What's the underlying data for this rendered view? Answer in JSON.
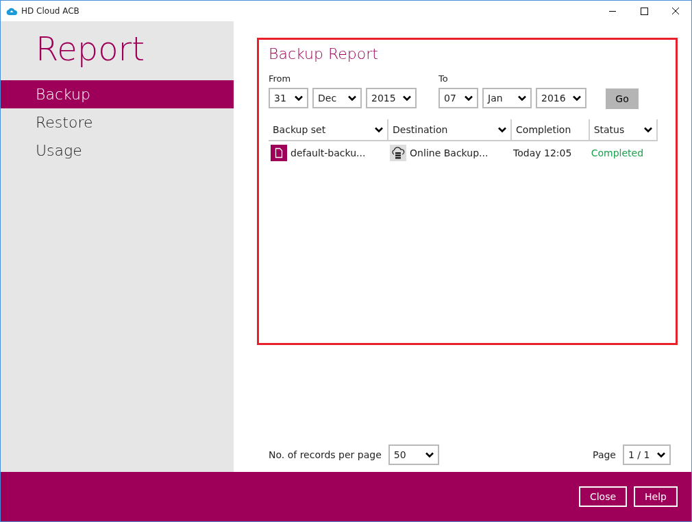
{
  "window": {
    "title": "HD Cloud ACB"
  },
  "sidebar": {
    "heading": "Report",
    "items": [
      {
        "label": "Backup",
        "selected": true
      },
      {
        "label": "Restore",
        "selected": false
      },
      {
        "label": "Usage",
        "selected": false
      }
    ]
  },
  "report": {
    "title": "Backup Report",
    "from": {
      "label": "From",
      "day": "31",
      "month": "Dec",
      "year": "2015"
    },
    "to": {
      "label": "To",
      "day": "07",
      "month": "Jan",
      "year": "2016"
    },
    "go_button": "Go",
    "table": {
      "columns": [
        {
          "label": "Backup set",
          "sortable": true
        },
        {
          "label": "Destination",
          "sortable": true
        },
        {
          "label": "Completion",
          "sortable": false
        },
        {
          "label": "Status",
          "sortable": true
        }
      ],
      "rows": [
        {
          "backup_set": "default-backu...",
          "destination": "Online Backup...",
          "completion": "Today 12:05",
          "status": "Completed"
        }
      ]
    }
  },
  "pagination": {
    "records_label": "No. of records per page",
    "records_value": "50",
    "page_label": "Page",
    "page_value": "1 / 1"
  },
  "footer": {
    "buttons": [
      "Close",
      "Help"
    ]
  }
}
